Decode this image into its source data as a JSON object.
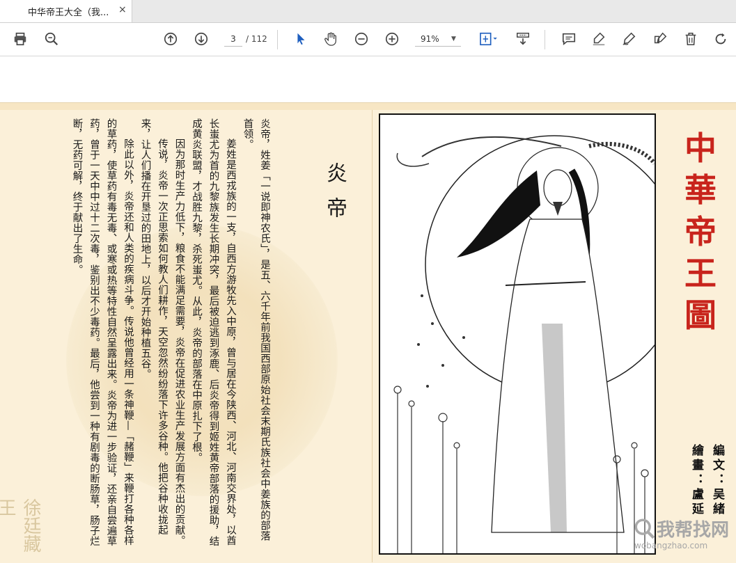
{
  "tab": {
    "title": "中华帝王大全（我...",
    "close": "×"
  },
  "toolbar": {
    "page_current": "3",
    "page_total": "/ 112",
    "zoom": "91%",
    "icons": [
      "print-icon",
      "zoom-search-icon",
      "page-up-icon",
      "page-down-icon",
      "select-cursor-icon",
      "hand-icon",
      "zoom-out-icon",
      "zoom-in-icon",
      "fit-page-icon",
      "scroll-mode-icon",
      "comment-icon",
      "highlight-icon",
      "sign-icon",
      "edit-icon",
      "delete-icon",
      "rotate-icon"
    ]
  },
  "document": {
    "heading": "炎帝",
    "paragraphs": [
      "炎帝，姓姜「一说即神农氏」，是五、六千年前我国西部原始社会末期氏族社会中姜族的部落首领。",
      "姜姓是西戎族的一支，自西方游牧先入中原，曾与居在今陕西、河北、河南交界处，以酋长蚩尤为首的九黎族发生长期冲突，最后被迫逃到涿鹿、后炎帝得到姬姓黄帝部落的援助，结成黄炎联盟，才战胜九黎，杀死蚩尤。从此，炎帝的部落在中原扎下了根。",
      "因为那时生产力低下，粮食不能满足需要，炎帝在促进农业生产发展方面有杰出的贡献。",
      "传说，炎帝一次正思索如何教人们耕作，天空忽然纷纷落下许多谷种。他把谷种收拢起来，让人们播在开垦过的田地上，以后才开始种植五谷。",
      "除此以外，炎帝还和人类的疾病斗争。传说他曾经用一条神鞭—「赭鞭」来鞭打各种各样的草药，使草药有毒无毒、或寒或热等特性自然呈露出来。炎帝为进一步验证，还亲自尝遍草药，曾于一天中中过十二次毒，鉴别出不少毒药。最后，他尝到一种有剧毒的断肠草，肠子烂断，无药可解，终于献出了生命。"
    ],
    "brand_chars": [
      "中",
      "華",
      "帝",
      "王",
      "圖"
    ],
    "credits": [
      "編文：吴緒",
      "繪畫：盧延"
    ],
    "seal_text": "徐廷藏王",
    "site_watermark": {
      "big": "我帮找网",
      "small": "wobangzhao.com"
    }
  }
}
